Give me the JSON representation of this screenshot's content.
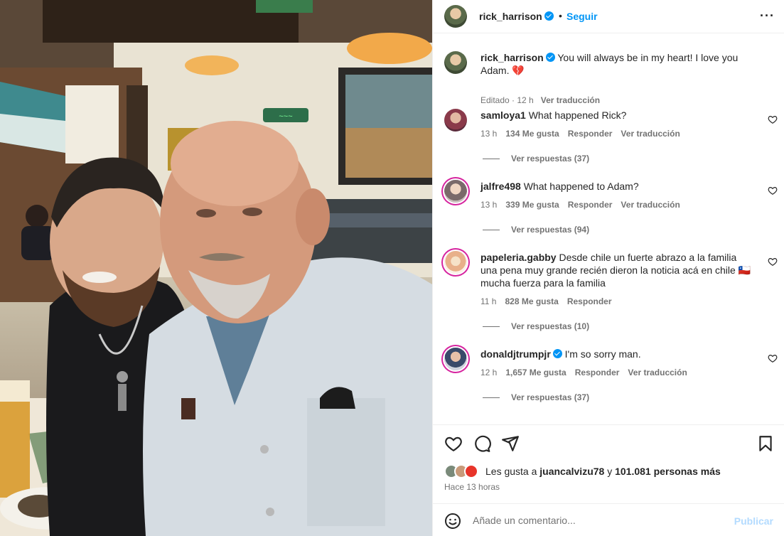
{
  "post": {
    "author": "rick_harrison",
    "follow_label": "Seguir",
    "more_icon": "more-horizontal-icon",
    "separator": "•"
  },
  "caption": {
    "username": "rick_harrison",
    "text": "You will always be in my heart! I love you Adam. 💔",
    "edited": "Editado · 12 h",
    "translate": "Ver traducción"
  },
  "comments": [
    {
      "username": "samloya1",
      "text": "What happened Rick?",
      "time": "13 h",
      "likes": "134 Me gusta",
      "reply": "Responder",
      "translate": "Ver traducción",
      "replies": "Ver respuestas (37)"
    },
    {
      "username": "jalfre498",
      "text": "What happened to Adam?",
      "time": "13 h",
      "likes": "339 Me gusta",
      "reply": "Responder",
      "translate": "Ver traducción",
      "replies": "Ver respuestas (94)"
    },
    {
      "username": "papeleria.gabby",
      "text": "Desde chile un fuerte abrazo a la familia una pena muy grande recién dieron la noticia acá en chile 🇨🇱 mucha fuerza para la familia",
      "time": "11 h",
      "likes": "828 Me gusta",
      "reply": "Responder",
      "translate": "",
      "replies": "Ver respuestas (10)"
    },
    {
      "username": "donaldjtrumpjr",
      "text": "I'm so sorry man.",
      "time": "12 h",
      "likes": "1,657 Me gusta",
      "reply": "Responder",
      "translate": "Ver traducción",
      "replies": "Ver respuestas (37)"
    }
  ],
  "actions": {
    "like_icon": "heart-icon",
    "comment_icon": "comment-icon",
    "share_icon": "share-icon",
    "save_icon": "bookmark-icon"
  },
  "likes": {
    "prefix": "Les gusta a ",
    "user": "juancalvizu78",
    "middle": " y ",
    "others": "101.081 personas más"
  },
  "time_ago": "Hace 13 horas",
  "comment_box": {
    "placeholder": "Añade un comentario...",
    "publish_label": "Publicar",
    "emoji_icon": "emoji-icon"
  },
  "colors": {
    "accent": "#0095f6",
    "text": "#262626",
    "secondary": "#737373",
    "publish_disabled": "#b3dbff"
  }
}
